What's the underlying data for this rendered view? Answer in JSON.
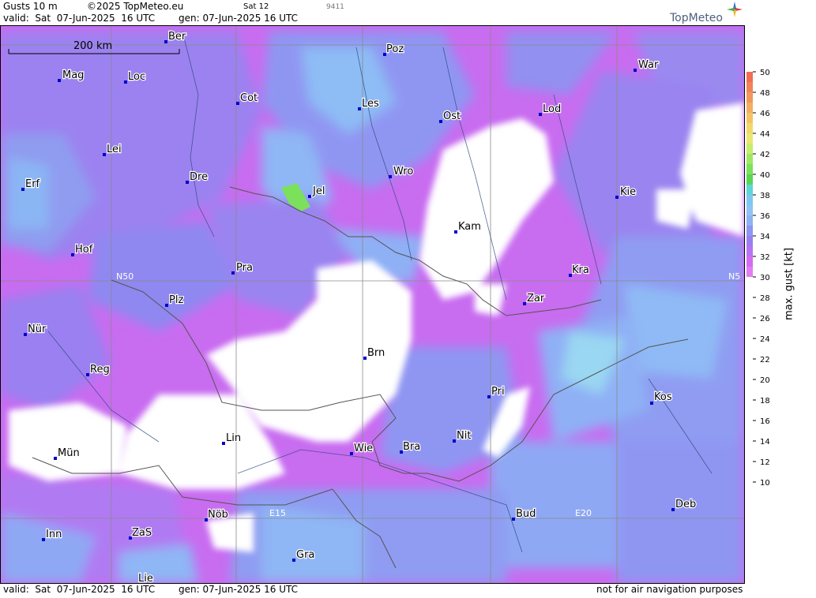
{
  "header": {
    "title": "Gusts 10 m",
    "copyright": "©2025 TopMeteo.eu",
    "run": "Sat 12",
    "code": "9411",
    "valid": "valid:  Sat  07-Jun-2025  16 UTC",
    "gen": "gen: 07-Jun-2025 16 UTC",
    "logo": "TopMeteo"
  },
  "footer": {
    "valid": "valid:  Sat  07-Jun-2025  16 UTC",
    "gen": "gen: 07-Jun-2025 16 UTC",
    "disclaimer": "not for air navigation purposes"
  },
  "scale_bar": "200 km",
  "grid_labels": {
    "n50": "N50",
    "n50_right": "N5",
    "e15": "E15",
    "e20": "E20"
  },
  "cities": [
    {
      "name": "Ber"
    },
    {
      "name": "Poz"
    },
    {
      "name": "War"
    },
    {
      "name": "Mag"
    },
    {
      "name": "Loc"
    },
    {
      "name": "Cot"
    },
    {
      "name": "Les"
    },
    {
      "name": "Ost"
    },
    {
      "name": "Lod"
    },
    {
      "name": "Lei"
    },
    {
      "name": "Dre"
    },
    {
      "name": "Wro"
    },
    {
      "name": "Jel"
    },
    {
      "name": "Erf"
    },
    {
      "name": "Kie"
    },
    {
      "name": "Kam"
    },
    {
      "name": "Hof"
    },
    {
      "name": "Pra"
    },
    {
      "name": "Kra"
    },
    {
      "name": "Zar"
    },
    {
      "name": "Plz"
    },
    {
      "name": "Nür"
    },
    {
      "name": "Brn"
    },
    {
      "name": "Reg"
    },
    {
      "name": "Pri"
    },
    {
      "name": "Kos"
    },
    {
      "name": "Lin"
    },
    {
      "name": "Nit"
    },
    {
      "name": "Wie"
    },
    {
      "name": "Bra"
    },
    {
      "name": "Mün"
    },
    {
      "name": "Deb"
    },
    {
      "name": "Nöb"
    },
    {
      "name": "Bud"
    },
    {
      "name": "Inn"
    },
    {
      "name": "ZaS"
    },
    {
      "name": "Gra"
    },
    {
      "name": "Lie"
    }
  ],
  "legend": {
    "label": "max. gust [kt]",
    "ticks": [
      "50",
      "48",
      "46",
      "44",
      "42",
      "40",
      "38",
      "36",
      "34",
      "32",
      "30",
      "28",
      "26",
      "24",
      "22",
      "20",
      "18",
      "16",
      "14",
      "12",
      "10"
    ],
    "colors": [
      "#f26d55",
      "#f08358",
      "#f1985d",
      "#f2ae62",
      "#f3c466",
      "#f2d86b",
      "#e8e870",
      "#c7ec6e",
      "#9fe864",
      "#79e35a",
      "#5ad655",
      "#5ed6d6",
      "#7cc8f0",
      "#8fc3f5",
      "#8fb2f5",
      "#8d96f0",
      "#9a7ff0",
      "#b774f2",
      "#d26cf2",
      "#e27df4"
    ]
  }
}
